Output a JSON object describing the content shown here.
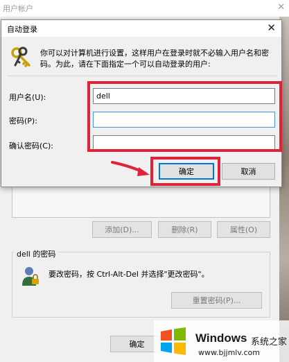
{
  "background_window": {
    "title": "用户帐户",
    "buttons": {
      "add": "添加(D)...",
      "remove": "删除(R)",
      "properties": "属性(O)",
      "reset_password": "重置密码(P)...",
      "ok": "确定"
    },
    "password_group": {
      "label": "dell 的密码",
      "hint": "要改密码，按 Ctrl-Alt-Del 并选择\"更改密码\"。"
    }
  },
  "dialog": {
    "title": "自动登录",
    "description": "你可以对计算机进行设置，这样用户在登录时就不必输入用户名和密码。为此，请在下面指定一个可以自动登录的用户:",
    "fields": {
      "username_label": "用户名(U):",
      "username_value": "dell",
      "password_label": "密码(P):",
      "password_value": "",
      "confirm_label": "确认密码(C):",
      "confirm_value": ""
    },
    "buttons": {
      "ok": "确定",
      "cancel": "取消"
    }
  },
  "watermark": {
    "brand": "Windows",
    "brand_cn": "系统之家",
    "url": "www.bjjmlv.com"
  },
  "colors": {
    "highlight_red": "#e0233a",
    "focus_blue": "#0078d7"
  },
  "icons": {
    "dialog_close": "close-icon",
    "dialog_keys": "keys-icon",
    "user": "user-icon",
    "windows_logo": "windows-logo-icon"
  }
}
